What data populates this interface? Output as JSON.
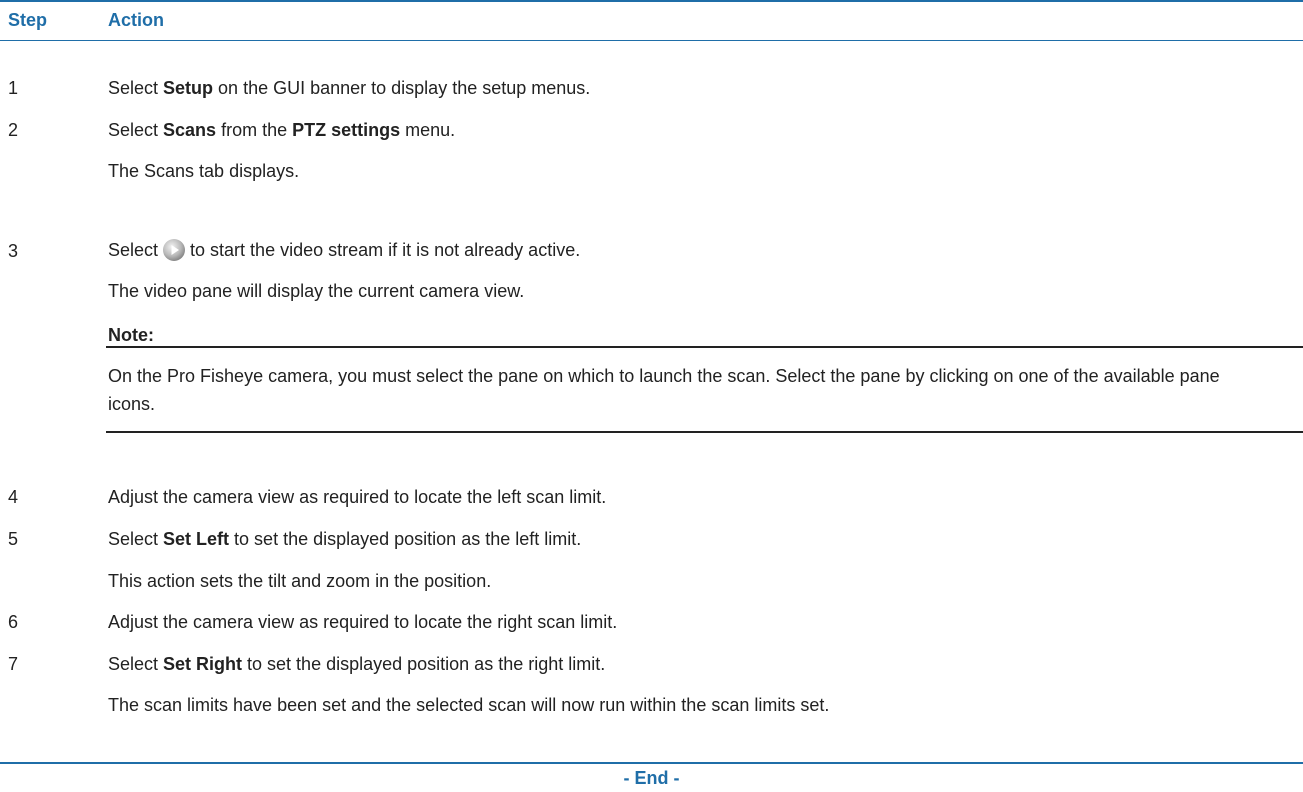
{
  "header": {
    "step": "Step",
    "action": "Action"
  },
  "steps": [
    {
      "number": "1",
      "action_parts": [
        "Select ",
        "Setup",
        " on the GUI banner to display the setup menus."
      ]
    },
    {
      "number": "2",
      "action_parts": [
        "Select ",
        "Scans",
        " from the ",
        "PTZ settings",
        " menu."
      ],
      "result": "The Scans tab displays."
    },
    {
      "number": "3",
      "action_before_icon": "Select",
      "icon": "play-button-icon",
      "action_after_icon": "to start the video stream if it is not already active.",
      "result": "The video pane will display the current camera view.",
      "note_label": "Note:",
      "note_text": "On the Pro Fisheye camera, you must select the pane on which to launch the scan. Select the pane by clicking on one of the available pane icons."
    },
    {
      "number": "4",
      "action": "Adjust the camera view as required to locate the left scan limit."
    },
    {
      "number": "5",
      "action_parts": [
        "Select ",
        "Set Left",
        " to set the displayed position as the left limit."
      ],
      "result": "This action sets the tilt and zoom in the position."
    },
    {
      "number": "6",
      "action": "Adjust the camera view as required to locate the right scan limit."
    },
    {
      "number": "7",
      "action_parts": [
        "Select ",
        "Set Right",
        " to set the displayed position as the right limit."
      ],
      "result": "The scan limits have been set and the selected scan will now run within the scan limits set."
    }
  ],
  "footer": {
    "end_label": "- End -"
  },
  "colors": {
    "accent": "#1f6ea8",
    "text": "#222222"
  }
}
